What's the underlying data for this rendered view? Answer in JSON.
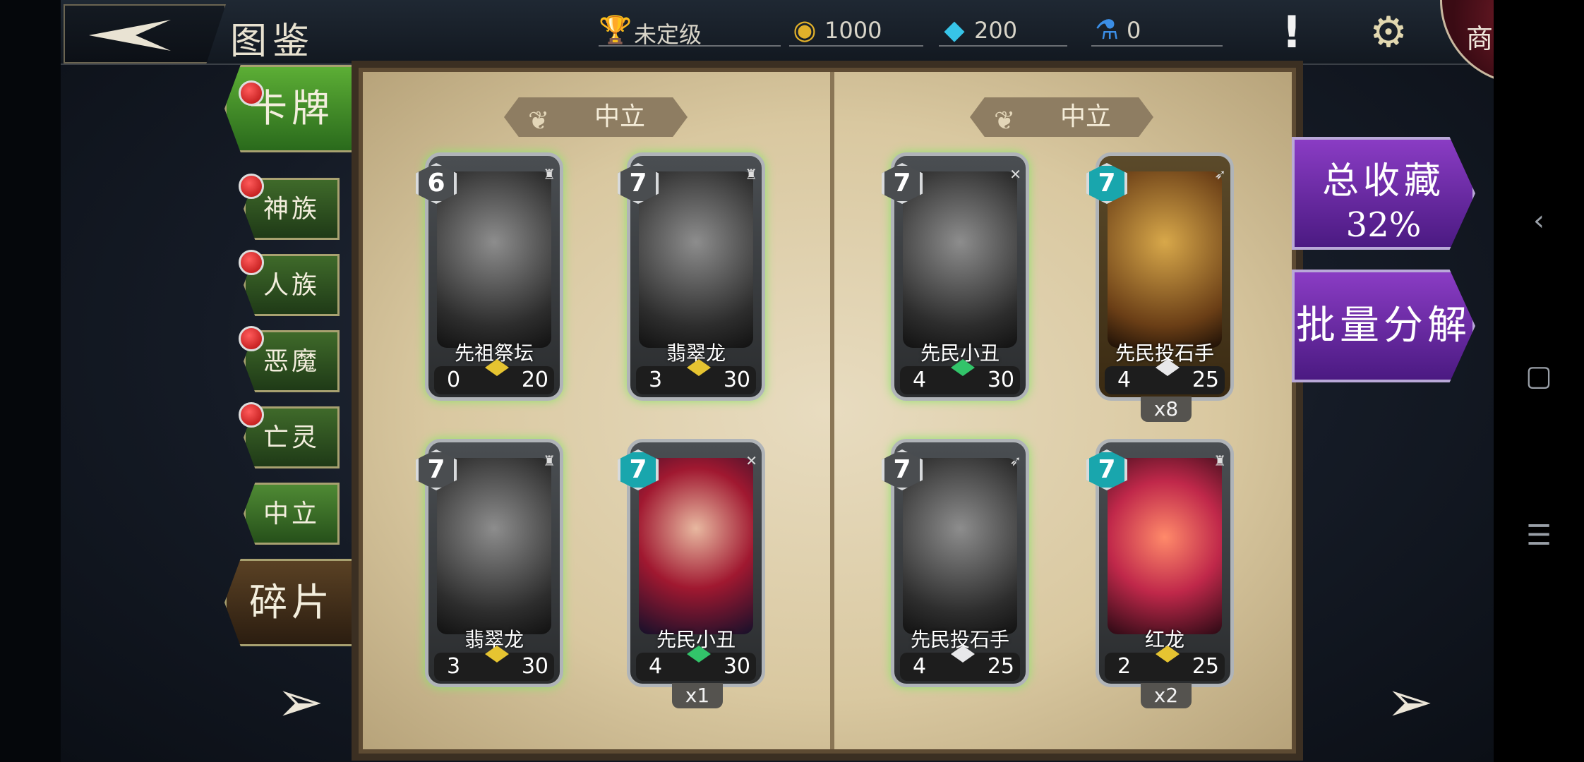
{
  "header": {
    "title": "图鉴",
    "rank_label": "未定级",
    "gold": "1000",
    "crystals": "200",
    "potions": "0",
    "shop_label": "商城"
  },
  "tabs": {
    "cards": "卡牌",
    "categories": [
      "神族",
      "人族",
      "恶魔",
      "亡灵",
      "中立"
    ],
    "fragments": "碎片"
  },
  "pages": {
    "left_label": "中立",
    "right_label": "中立"
  },
  "cards": [
    {
      "name": "先祖祭坛",
      "cost": "6",
      "attack": "0",
      "health": "20",
      "count": ""
    },
    {
      "name": "翡翠龙",
      "cost": "7",
      "attack": "3",
      "health": "30",
      "count": ""
    },
    {
      "name": "先民小丑",
      "cost": "7",
      "attack": "4",
      "health": "30",
      "count": ""
    },
    {
      "name": "先民投石手",
      "cost": "7",
      "attack": "4",
      "health": "25",
      "count": "x8"
    },
    {
      "name": "翡翠龙",
      "cost": "7",
      "attack": "3",
      "health": "30",
      "count": ""
    },
    {
      "name": "先民小丑",
      "cost": "7",
      "attack": "4",
      "health": "30",
      "count": "x1"
    },
    {
      "name": "先民投石手",
      "cost": "7",
      "attack": "4",
      "health": "25",
      "count": ""
    },
    {
      "name": "红龙",
      "cost": "7",
      "attack": "2",
      "health": "25",
      "count": "x2"
    }
  ],
  "collection": {
    "label": "总收藏",
    "percent": "32%"
  },
  "decompose_label": "批量分解",
  "colors": {
    "tab_green": "#3f6a2a",
    "purple_button": "#6a2aa6",
    "cost_teal": "#19a6ad",
    "page_paper": "#d9c8a0"
  },
  "icons": {
    "back": "back-arrow-icon",
    "rank": "trophy-icon",
    "gold": "coin-icon",
    "crystals": "crystal-icon",
    "potions": "potion-icon",
    "alert": "exclamation-icon",
    "settings": "gear-icon",
    "prev": "left-arrow-icon",
    "next": "right-arrow-icon"
  }
}
